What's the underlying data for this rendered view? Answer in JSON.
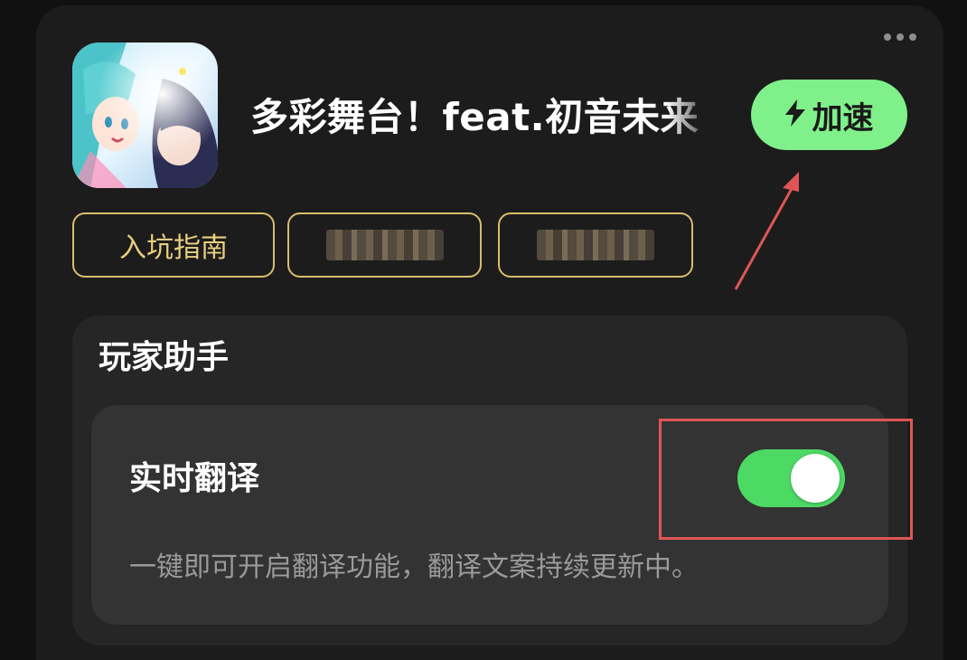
{
  "game": {
    "title": "多彩舞台！feat.初音未来（",
    "icon": "game-app-icon"
  },
  "header": {
    "more_icon": "more-horizontal-icon"
  },
  "speed_button": {
    "label": "加速",
    "icon": "lightning-icon",
    "color": "#7ff08a"
  },
  "chips": [
    {
      "label": "入坑指南",
      "blurred": false
    },
    {
      "label": "",
      "blurred": true
    },
    {
      "label": "",
      "blurred": true
    }
  ],
  "assistant": {
    "title": "玩家助手",
    "feature": {
      "title": "实时翻译",
      "description": "一键即可开启翻译功能，翻译文案持续更新中。",
      "toggle_on": true,
      "toggle_color": "#4cd964"
    }
  },
  "annotations": {
    "color": "#e05555",
    "items": [
      "arrow-to-speed-button",
      "box-around-toggle"
    ]
  }
}
